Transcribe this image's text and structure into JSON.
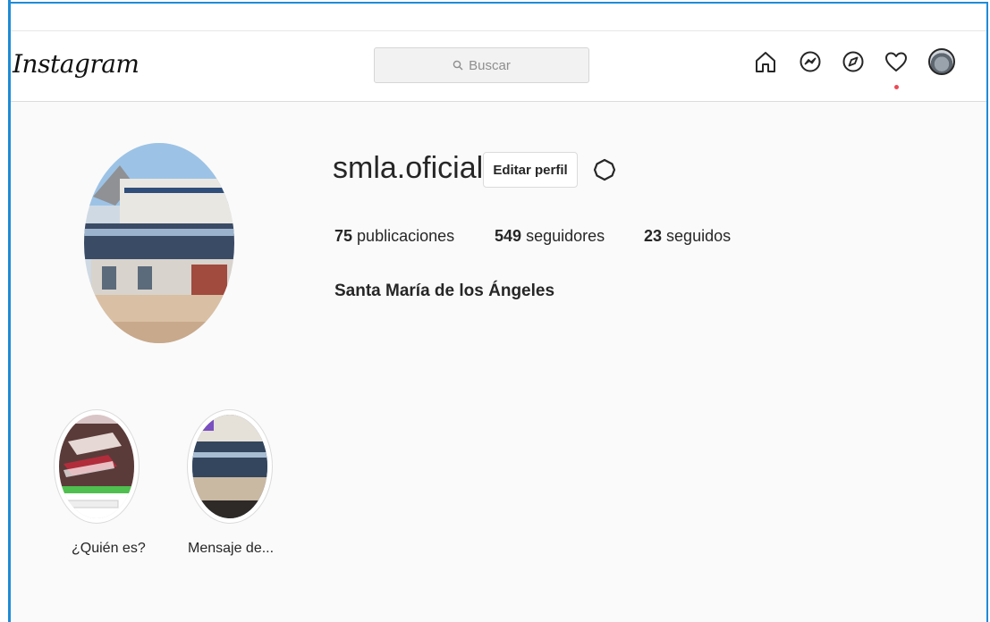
{
  "header": {
    "logo": "Instagram",
    "search_placeholder": "Buscar"
  },
  "nav": {
    "icons": [
      "home-icon",
      "messenger-icon",
      "explore-icon",
      "activity-heart-icon",
      "profile-avatar"
    ],
    "notification_dot_color": "#ed4956"
  },
  "profile": {
    "username": "smla.oficial",
    "edit_label": "Editar perfil",
    "posts_count": "75",
    "posts_label": "publicaciones",
    "followers_count": "549",
    "followers_label": "seguidores",
    "following_count": "23",
    "following_label": "seguidos",
    "full_name": "Santa María de los Ángeles"
  },
  "highlights": [
    {
      "label": "¿Quién es?"
    },
    {
      "label": "Mensaje de..."
    }
  ],
  "colors": {
    "frame_blue": "#1f8bd6",
    "background": "#fafafa",
    "text": "#262626"
  }
}
